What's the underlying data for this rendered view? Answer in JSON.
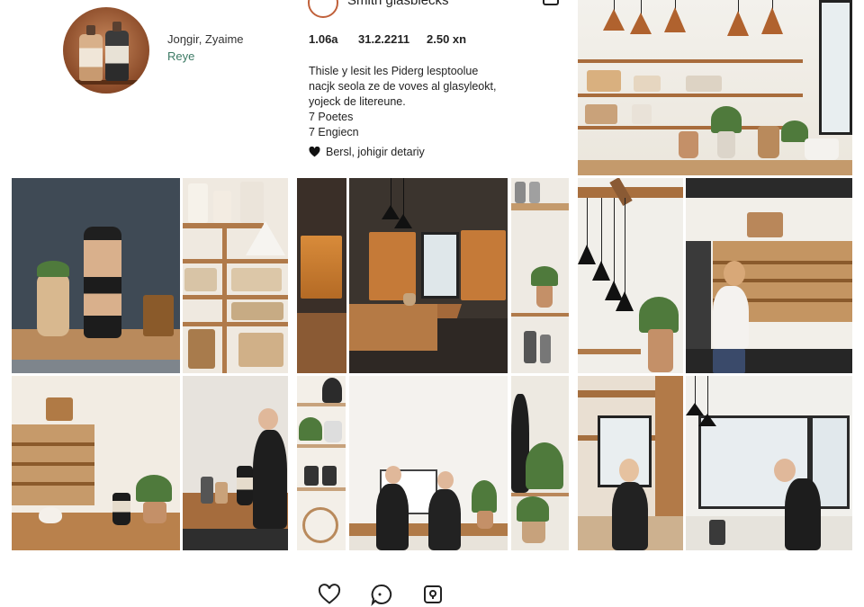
{
  "profile": {
    "name": "Joŋgir, Zyaime",
    "subtitle": "Reye",
    "title": "Smith glasblecks",
    "stats": [
      "1.06a",
      "31.2.2211",
      "2.50 xn"
    ],
    "bio_lines": [
      "Thisle y lesit les Piderg lesptoolue",
      "nacjk seola ze de voves al glasyleokt,",
      "yojeck de litereune.",
      "7 Poetes",
      "7 Engiecn"
    ],
    "followed_by": "Bersl, johigir detariy"
  },
  "actions": {
    "like_icon": "heart-icon",
    "comment_icon": "comment-icon",
    "share_icon": "share-icon"
  },
  "colors": {
    "accent": "#c0603a",
    "subtitle": "#3c7a64"
  }
}
